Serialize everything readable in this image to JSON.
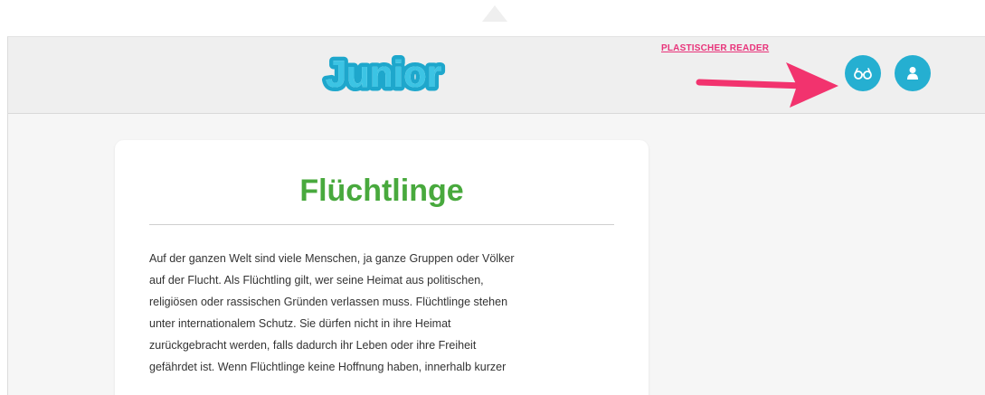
{
  "header": {
    "logo_text": "Junior",
    "annotation_label": "PLASTISCHER READER",
    "reader_button_icon": "glasses-icon",
    "profile_button_icon": "user-icon"
  },
  "article": {
    "title": "Flüchtlinge",
    "lines": [
      "Auf der ganzen Welt sind viele Menschen, ja ganze Gruppen oder Völker",
      "auf der Flucht. Als Flüchtling gilt, wer seine Heimat aus politischen,",
      "religiösen oder rassischen Gründen verlassen muss. Flüchtlinge stehen",
      "unter internationalem Schutz. Sie dürfen nicht in ihre Heimat",
      "zurückgebracht werden, falls dadurch ihr Leben oder ihre Freiheit",
      "gefährdet ist. Wenn Flüchtlinge keine Hoffnung haben, innerhalb kurzer"
    ]
  },
  "colors": {
    "brand_blue": "#25afd1",
    "title_green": "#48a93d",
    "annotation_pink": "#e8337a"
  }
}
